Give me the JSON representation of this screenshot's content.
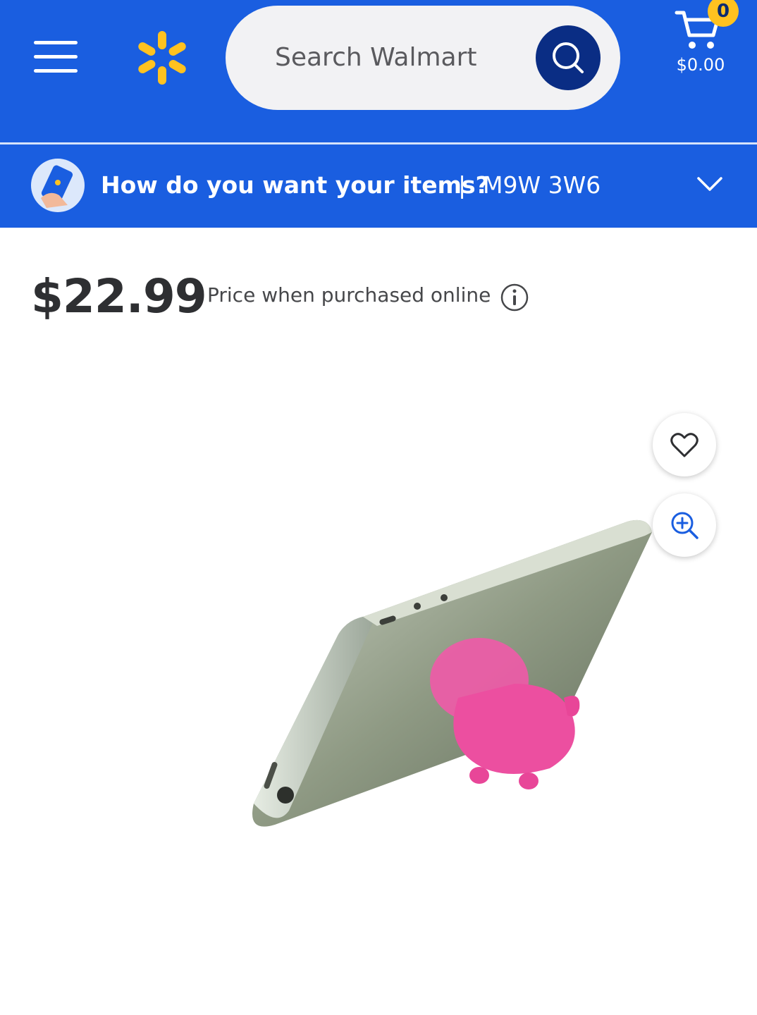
{
  "header": {
    "search": {
      "placeholder": "Search Walmart"
    },
    "cart": {
      "count": "0",
      "total": "$0.00"
    },
    "icons": {
      "menu": "menu-icon",
      "logo": "walmart-spark-logo",
      "search": "search-icon",
      "cart": "cart-icon"
    },
    "colors": {
      "brand_blue": "#1a5ee0",
      "dark_blue": "#0a2d84",
      "spark_yellow": "#ffc220"
    }
  },
  "fulfillment": {
    "prompt": "How do you want your items?",
    "separator": "|",
    "postal_code": "M9W 3W6"
  },
  "product": {
    "price": "$22.99",
    "price_note": "Price when purchased online",
    "image_description_icon": "phone-stand-image",
    "actions": {
      "favorite": "heart-icon",
      "zoom": "zoom-in-icon"
    }
  }
}
